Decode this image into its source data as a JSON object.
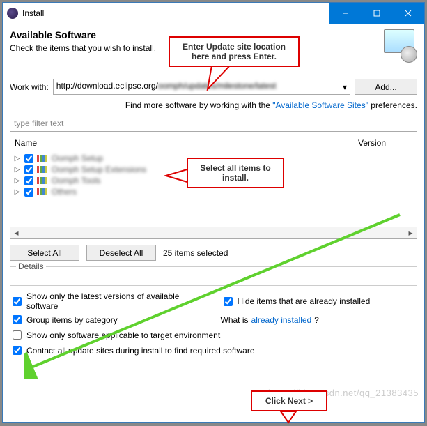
{
  "window": {
    "title": "Install"
  },
  "header": {
    "title": "Available Software",
    "subtitle": "Check the items that you wish to install."
  },
  "work_with": {
    "label": "Work with:",
    "value": "http://download.eclipse.org/",
    "add_button": "Add..."
  },
  "hint": {
    "prefix": "Find more software by working with the ",
    "link": "\"Available Software Sites\"",
    "suffix": " preferences."
  },
  "filter_placeholder": "type filter text",
  "columns": {
    "name": "Name",
    "version": "Version"
  },
  "tree_items": [
    {
      "label": "Oomph Setup",
      "checked": true
    },
    {
      "label": "Oomph Setup Extensions",
      "checked": true
    },
    {
      "label": "Oomph Tools",
      "checked": true
    },
    {
      "label": "Others",
      "checked": true
    }
  ],
  "selection": {
    "select_all": "Select All",
    "deselect_all": "Deselect All",
    "count_text": "25 items selected"
  },
  "details_label": "Details",
  "options": {
    "latest_only": "Show only the latest versions of available software",
    "hide_installed": "Hide items that are already installed",
    "group_category": "Group items by category",
    "what_is_prefix": "What is ",
    "what_is_link": "already installed",
    "what_is_suffix": "?",
    "target_env": "Show only software applicable to target environment",
    "contact_sites": "Contact all update sites during install to find required software"
  },
  "callouts": {
    "c1": "Enter Update site location here and press Enter.",
    "c2": "Select all items to install.",
    "c3": "Click Next >"
  },
  "watermark": "https://blog.csdn.net/qq_21383435"
}
